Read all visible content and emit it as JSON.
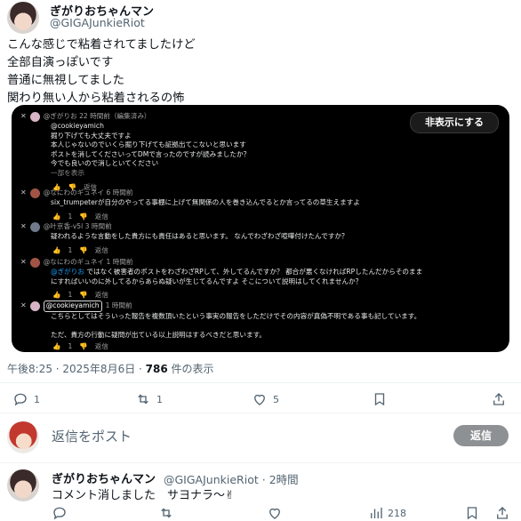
{
  "tweet": {
    "author_name": "ぎがりおちゃんマン",
    "author_handle": "@GIGAJunkieRiot",
    "lines": [
      "こんな感じで粘着されてましたけど",
      "全部自演っぽいです",
      "普通に無視してました",
      "関わり無い人から粘着されるの怖"
    ],
    "time": "午後8:25 · 2025年8月6日 · ",
    "views": "786",
    "views_suffix": " 件の表示",
    "replies": "1",
    "retweets": "1",
    "likes": "5"
  },
  "screenshot": {
    "hide_button": "非表示にする",
    "comments": [
      {
        "header": "@ぎがりお 22 時間前（編集済み）",
        "mention": "@cookieyamich",
        "lines": [
          "掘り下げても大丈夫ですよ",
          "本人じゃないのでいくら掘り下げても証拠出てこないと思います",
          "ポストを消してくださいってDMで言ったのですが読みましたか？",
          "今でも良いので消しといてください"
        ],
        "more": "一部を表示",
        "likes": "",
        "reply": "返信"
      },
      {
        "header": "@なにわのギュネイ 6 時間前",
        "lines": [
          "six_trumpeterが自分のやってる事棚に上げて無関係の人を巻き込んでるとか言ってるの草生えますよ"
        ],
        "likes": "1",
        "reply": "返信"
      },
      {
        "header": "@叶京香-v5l 3 時間前",
        "lines": [
          "疑われるような言動をした貴方にも責任はあると思います。 なんでわざわざ喧嘩付けたんですか？"
        ],
        "likes": "1",
        "reply": "返信"
      },
      {
        "header": "@なにわのギュネイ 1 時間前",
        "mention": "@ぎがりお",
        "lines": [
          "ではなく被害者のポストをわざわざRPして、外してるんですか？ 都合が悪くなければRPしたんだからそのまま",
          "にすればいいのに外してるからあらぬ疑いが生じてるんですよ そこについて説明はしてくれませんか？"
        ],
        "likes": "1",
        "reply": "返信"
      },
      {
        "tag": "@cookieyamich",
        "header": "1 時間前",
        "lines": [
          "こちらとしてはそういった報告を複数頂いたという事実の報告をしただけでその内容が真偽不明である事も記しています。",
          "",
          "ただ、貴方の行動に疑問が出ている以上説明はするべきだと思います。"
        ],
        "likes": "1",
        "reply": "返信"
      }
    ]
  },
  "reply_box": {
    "placeholder": "返信をポスト",
    "button": "返信"
  },
  "tweet2": {
    "author_name": "ぎがりおちゃんマン",
    "author_handle": "@GIGAJunkieRiot",
    "time": "· 2時間",
    "text": "コメント消しました　サヨナラ～✌",
    "views": "218"
  }
}
